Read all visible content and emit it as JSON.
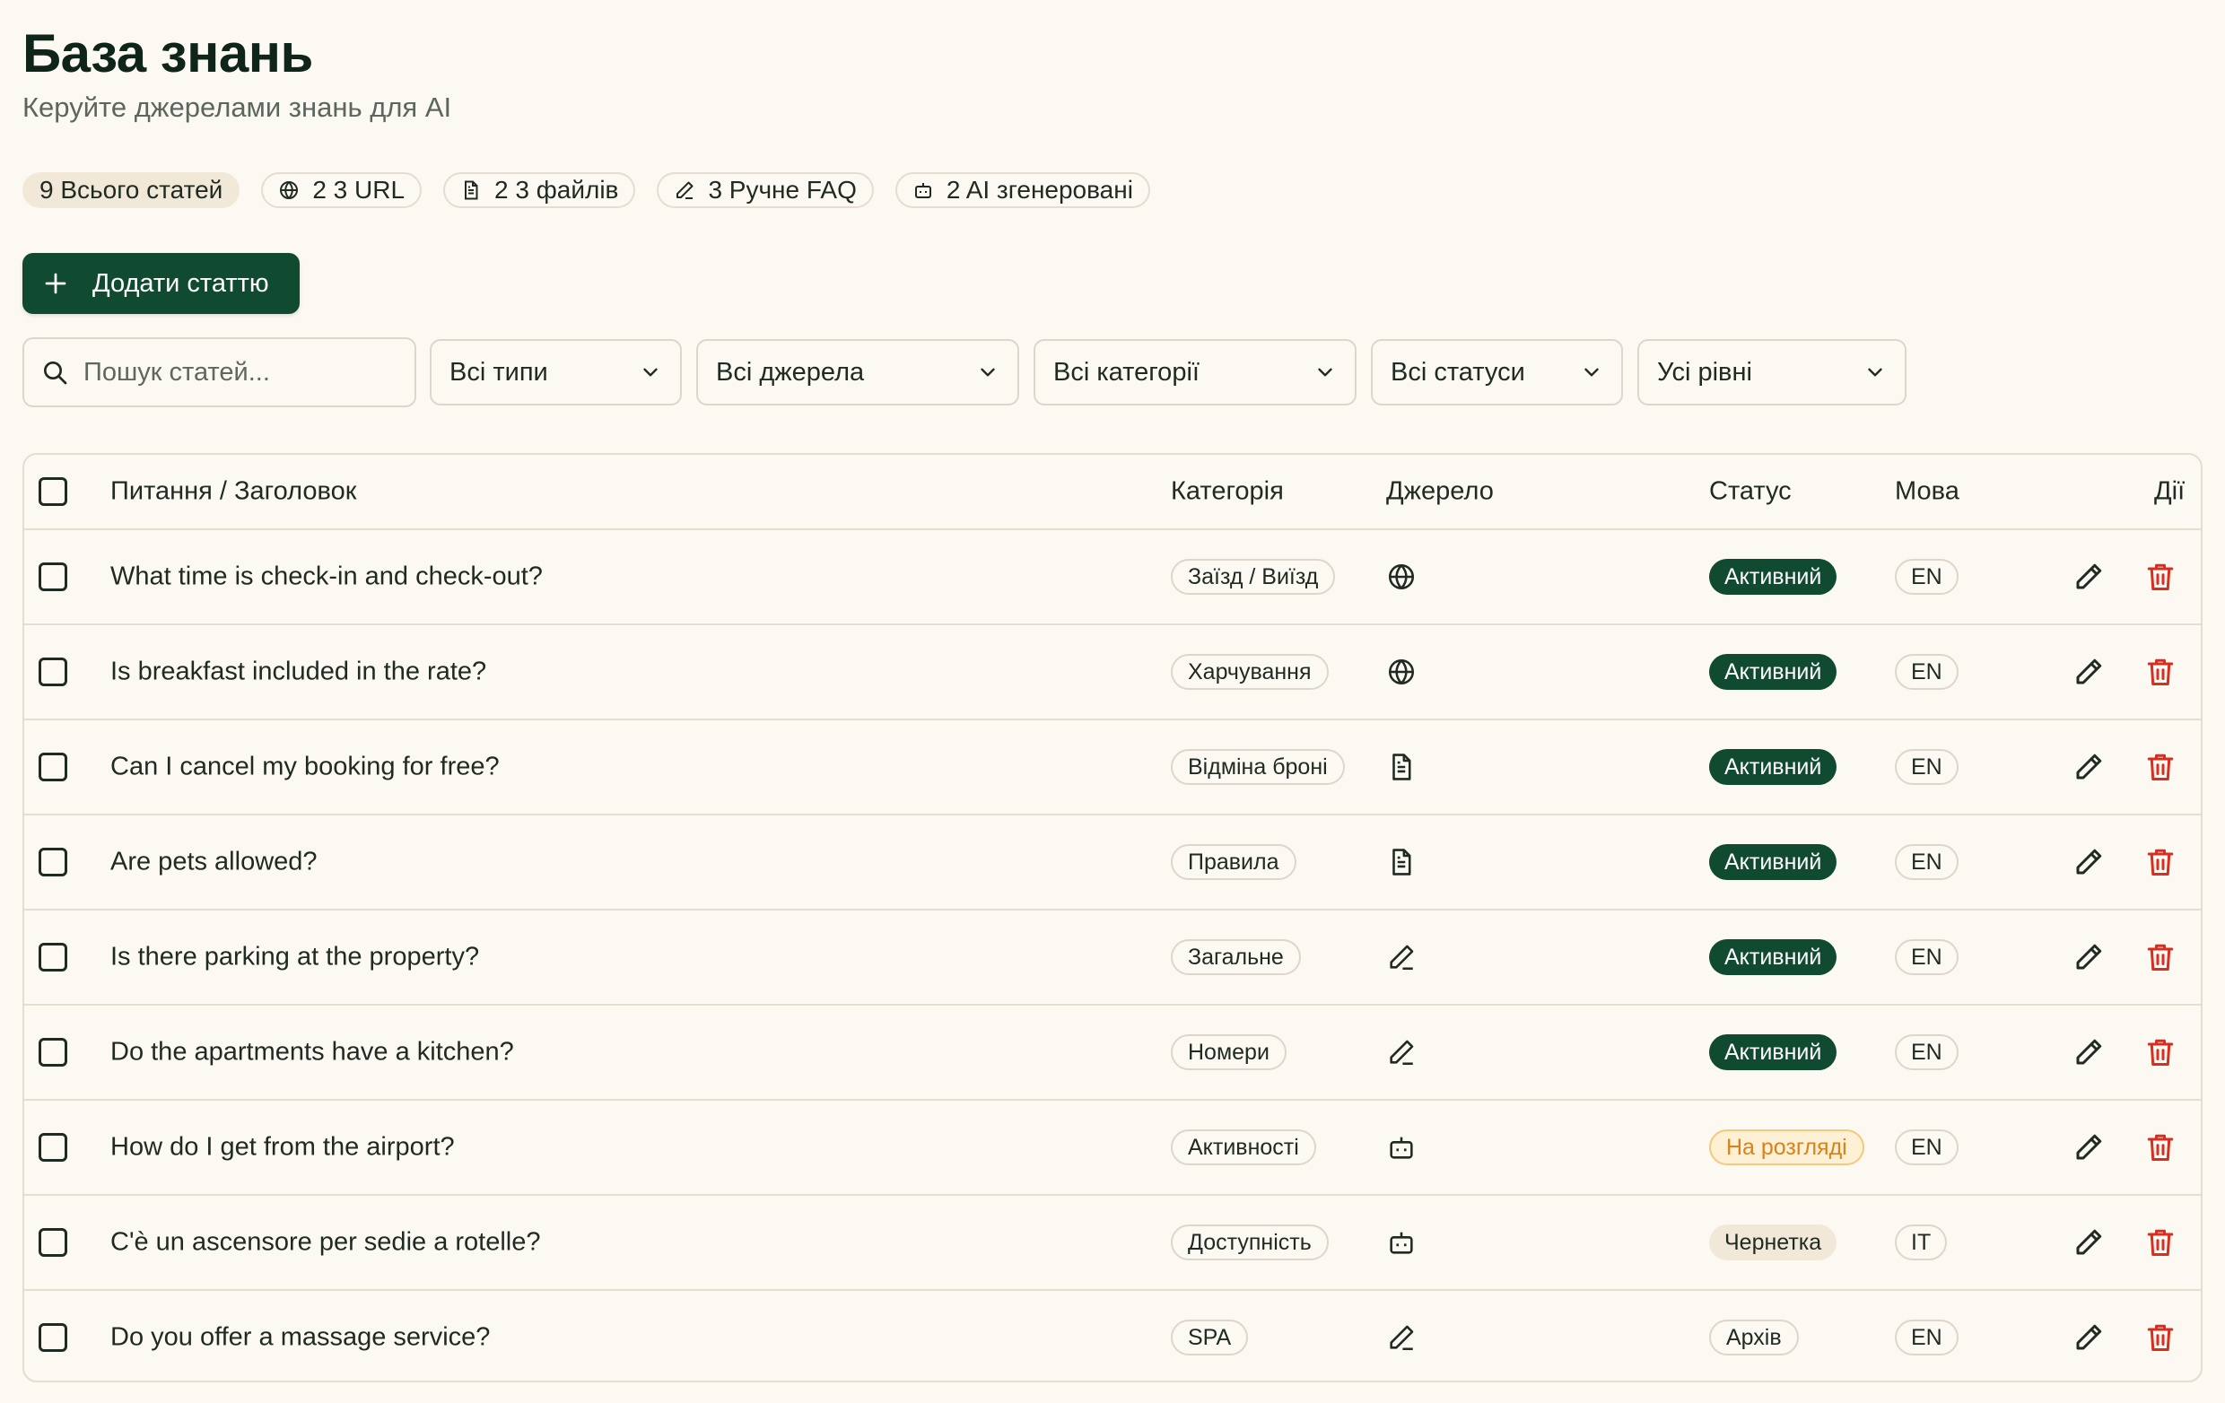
{
  "header": {
    "title": "База знань",
    "subtitle": "Керуйте джерелами знань для AI"
  },
  "stats": {
    "total": "9 Всього статей",
    "url": "2 3 URL",
    "files": "2 3 файлів",
    "manual": "3 Ручне FAQ",
    "ai": "2 AI згенеровані"
  },
  "add_button": {
    "label": "Додати статтю",
    "icon": "plus-icon"
  },
  "filters": {
    "search_placeholder": "Пошук статей...",
    "types": "Всі типи",
    "sources": "Всі джерела",
    "categories": "Всі категорії",
    "statuses": "Всі статуси",
    "levels": "Усі рівні"
  },
  "table": {
    "columns": {
      "question": "Питання / Заголовок",
      "category": "Категорія",
      "source": "Джерело",
      "status": "Статус",
      "language": "Мова",
      "actions": "Дії"
    },
    "rows": [
      {
        "question": "What time is check-in and check-out?",
        "category": "Заїзд / Виїзд",
        "source": "globe-icon",
        "status": "Активний",
        "status_type": "active",
        "language": "EN"
      },
      {
        "question": "Is breakfast included in the rate?",
        "category": "Харчування",
        "source": "globe-icon",
        "status": "Активний",
        "status_type": "active",
        "language": "EN"
      },
      {
        "question": "Can I cancel my booking for free?",
        "category": "Відміна броні",
        "source": "file-icon",
        "status": "Активний",
        "status_type": "active",
        "language": "EN"
      },
      {
        "question": "Are pets allowed?",
        "category": "Правила",
        "source": "file-icon",
        "status": "Активний",
        "status_type": "active",
        "language": "EN"
      },
      {
        "question": "Is there parking at the property?",
        "category": "Загальне",
        "source": "pen-icon",
        "status": "Активний",
        "status_type": "active",
        "language": "EN"
      },
      {
        "question": "Do the apartments have a kitchen?",
        "category": "Номери",
        "source": "pen-icon",
        "status": "Активний",
        "status_type": "active",
        "language": "EN"
      },
      {
        "question": "How do I get from the airport?",
        "category": "Активності",
        "source": "bot-icon",
        "status": "На розгляді",
        "status_type": "review",
        "language": "EN"
      },
      {
        "question": "C'è un ascensore per sedie a rotelle?",
        "category": "Доступність",
        "source": "bot-icon",
        "status": "Чернетка",
        "status_type": "draft",
        "language": "IT"
      },
      {
        "question": "Do you offer a massage service?",
        "category": "SPA",
        "source": "pen-icon",
        "status": "Архів",
        "status_type": "archive",
        "language": "EN"
      }
    ]
  },
  "colors": {
    "background": "#fcf9f3",
    "primary": "#0f4a31",
    "danger": "#d92d20",
    "review": "#d9821b"
  }
}
